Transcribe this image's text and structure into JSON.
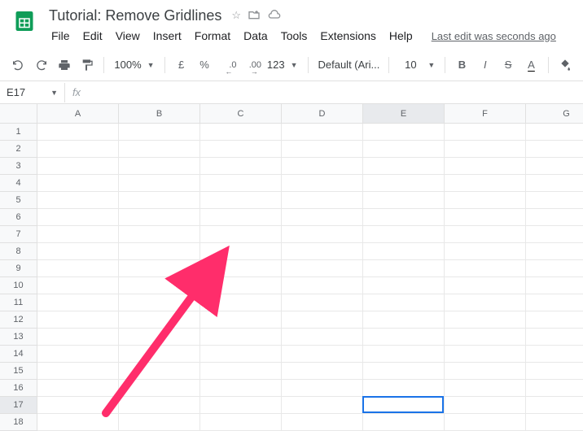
{
  "header": {
    "title": "Tutorial: Remove Gridlines"
  },
  "menu": {
    "file": "File",
    "edit": "Edit",
    "view": "View",
    "insert": "Insert",
    "format": "Format",
    "data": "Data",
    "tools": "Tools",
    "extensions": "Extensions",
    "help": "Help",
    "last_edit": "Last edit was seconds ago"
  },
  "toolbar": {
    "zoom": "100%",
    "currency": "£",
    "percent": "%",
    "dec_decrease": ".0",
    "dec_increase": ".00",
    "format_123": "123",
    "font": "Default (Ari...",
    "font_size": "10",
    "bold": "B",
    "italic": "I",
    "strike": "S",
    "textcolor": "A"
  },
  "namebox": {
    "ref": "E17",
    "fx": "fx"
  },
  "columns": [
    "A",
    "B",
    "C",
    "D",
    "E",
    "F",
    "G"
  ],
  "rows": [
    "1",
    "2",
    "3",
    "4",
    "5",
    "6",
    "7",
    "8",
    "9",
    "10",
    "11",
    "12",
    "13",
    "14",
    "15",
    "16",
    "17",
    "18"
  ],
  "selected": {
    "col_index": 4,
    "row_index": 16
  }
}
